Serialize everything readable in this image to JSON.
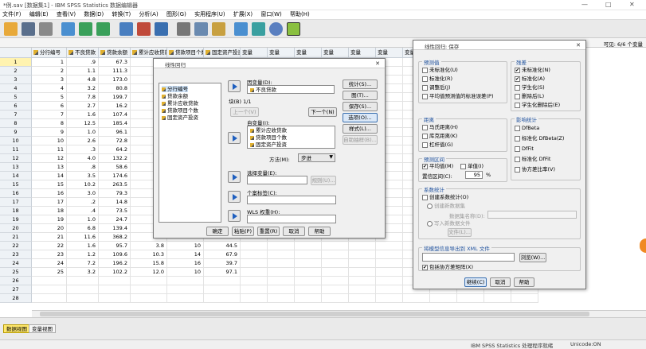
{
  "window": {
    "title": "*例.sav [数据集1] - IBM SPSS Statistics 数据编辑器",
    "minimize": "—",
    "maximize": "□",
    "close": "✕"
  },
  "menubar": [
    "文件(F)",
    "编辑(E)",
    "查看(V)",
    "数据(D)",
    "转换(T)",
    "分析(A)",
    "图形(G)",
    "实用程序(U)",
    "扩展(X)",
    "窗口(W)",
    "帮助(H)"
  ],
  "varinfo": {
    "visible": "可见: 6/6 个变量"
  },
  "grid": {
    "columns": [
      "分行编号",
      "不良贷款",
      "贷款余额",
      "累计应收贷款",
      "贷款项目个数",
      "固定资产投资",
      "变量",
      "变量",
      "变量",
      "变量",
      "变量",
      "变量",
      "变量",
      "变量",
      "变量",
      "变量",
      "变量"
    ],
    "rows": [
      [
        "1",
        "1",
        ".9",
        "67.3",
        "",
        "",
        ""
      ],
      [
        "2",
        "2",
        "1.1",
        "111.3",
        "",
        "",
        ""
      ],
      [
        "3",
        "3",
        "4.8",
        "173.0",
        "",
        "",
        ""
      ],
      [
        "4",
        "4",
        "3.2",
        "80.8",
        "",
        "",
        ""
      ],
      [
        "5",
        "5",
        "7.8",
        "199.7",
        "",
        "",
        ""
      ],
      [
        "6",
        "6",
        "2.7",
        "16.2",
        "",
        "",
        ""
      ],
      [
        "7",
        "7",
        "1.6",
        "107.4",
        "",
        "",
        ""
      ],
      [
        "8",
        "8",
        "12.5",
        "185.4",
        "",
        "",
        ""
      ],
      [
        "9",
        "9",
        "1.0",
        "96.1",
        "",
        "",
        ""
      ],
      [
        "10",
        "10",
        "2.6",
        "72.8",
        "",
        "",
        ""
      ],
      [
        "11",
        "11",
        ".3",
        "64.2",
        "",
        "",
        ""
      ],
      [
        "12",
        "12",
        "4.0",
        "132.2",
        "",
        "",
        ""
      ],
      [
        "13",
        "13",
        ".8",
        "58.6",
        "",
        "",
        ""
      ],
      [
        "14",
        "14",
        "3.5",
        "174.6",
        "",
        "",
        ""
      ],
      [
        "15",
        "15",
        "10.2",
        "263.5",
        "",
        "",
        ""
      ],
      [
        "16",
        "16",
        "3.0",
        "79.3",
        "",
        "",
        ""
      ],
      [
        "17",
        "17",
        ".2",
        "14.8",
        "",
        "",
        ""
      ],
      [
        "18",
        "18",
        ".4",
        "73.5",
        "",
        "",
        ""
      ],
      [
        "19",
        "19",
        "1.0",
        "24.7",
        "",
        "",
        ""
      ],
      [
        "20",
        "20",
        "6.8",
        "139.4",
        "",
        "",
        ""
      ],
      [
        "21",
        "21",
        "11.6",
        "368.2",
        "16.8",
        "32",
        "163.9"
      ],
      [
        "22",
        "22",
        "1.6",
        "95.7",
        "3.8",
        "10",
        "44.5"
      ],
      [
        "23",
        "23",
        "1.2",
        "109.6",
        "10.3",
        "14",
        "67.9"
      ],
      [
        "24",
        "24",
        "7.2",
        "196.2",
        "15.8",
        "16",
        "39.7"
      ],
      [
        "25",
        "25",
        "3.2",
        "102.2",
        "12.0",
        "10",
        "97.1"
      ],
      [
        "26",
        "",
        "",
        "",
        "",
        "",
        ""
      ],
      [
        "27",
        "",
        "",
        "",
        "",
        "",
        ""
      ],
      [
        "28",
        "",
        "",
        "",
        "",
        "",
        ""
      ]
    ]
  },
  "tabs": {
    "data_view": "数据视图",
    "variable_view": "变量视图"
  },
  "status": {
    "processor": "IBM SPSS Statistics 处理程序就绪",
    "unicode": "Unicode:ON"
  },
  "linreg": {
    "title": "线性回归",
    "source_vars": [
      "分行编号",
      "贷款余额",
      "累计应收贷款",
      "贷款项目个数",
      "固定资产投资"
    ],
    "dependent_label": "因变量(D):",
    "dependent_value": "不良贷款",
    "block_label": "块(B) 1/1",
    "prev": "上一个(V)",
    "next": "下一个(N)",
    "independent_label": "自变量(I):",
    "independent_vars": [
      "累计应收贷款",
      "贷款项目个数",
      "固定资产投资"
    ],
    "method_label": "方法(M):",
    "method_value": "步进",
    "selection_label": "选择变量(E):",
    "rule_btn": "规则(U)...",
    "case_label": "个案标签(C):",
    "wls_label": "WLS 权重(H):",
    "side_buttons": [
      "统计(S)...",
      "图(T)...",
      "保存(S)...",
      "选项(O)...",
      "样式(L)...",
      "自助抽样(B)..."
    ],
    "bottom_buttons": [
      "确定",
      "粘贴(P)",
      "重置(R)",
      "取消",
      "帮助"
    ]
  },
  "save": {
    "title": "线性回归: 保存",
    "pred_title": "预测值",
    "pred": [
      "未标准化(U)",
      "标准化(R)",
      "调整后(J)",
      "平均值预测值的标准误差(P)"
    ],
    "resid_title": "残差",
    "resid": [
      "未标准化(N)",
      "标准化(A)",
      "学生化(S)",
      "删除后(L)",
      "学生化删除后(E)"
    ],
    "dist_title": "距离",
    "dist": [
      "马氏距离(H)",
      "库克距离(K)",
      "杠杆值(G)"
    ],
    "infl_title": "影响统计",
    "infl": [
      "DfBeta",
      "标准化 DfBeta(Z)",
      "DfFit",
      "标准化 DfFit",
      "协方差比率(V)"
    ],
    "interval_title": "预测区间",
    "interval": [
      "平均值(M)",
      "单值(I)"
    ],
    "conf_label": "置信区间(C):",
    "conf_value": "95",
    "pct": "%",
    "coef_title": "系数统计",
    "coef_create": "创建系数统计(O)",
    "coef_new": "创建新数据集",
    "coef_new_name": "数据集名称(D):",
    "coef_write": "写入新数据文件",
    "file_btn": "文件(L)...",
    "xml_title": "将模型信息导出到 XML 文件",
    "browse": "浏览(W)...",
    "include_cov": "包括协方差矩阵(X)",
    "continue": "继续(C)",
    "cancel": "取消",
    "help": "帮助"
  },
  "colors": {
    "accent": "#1d4f9c",
    "active_tab": "#ffe86b",
    "header_bg": "#eef2f6"
  }
}
